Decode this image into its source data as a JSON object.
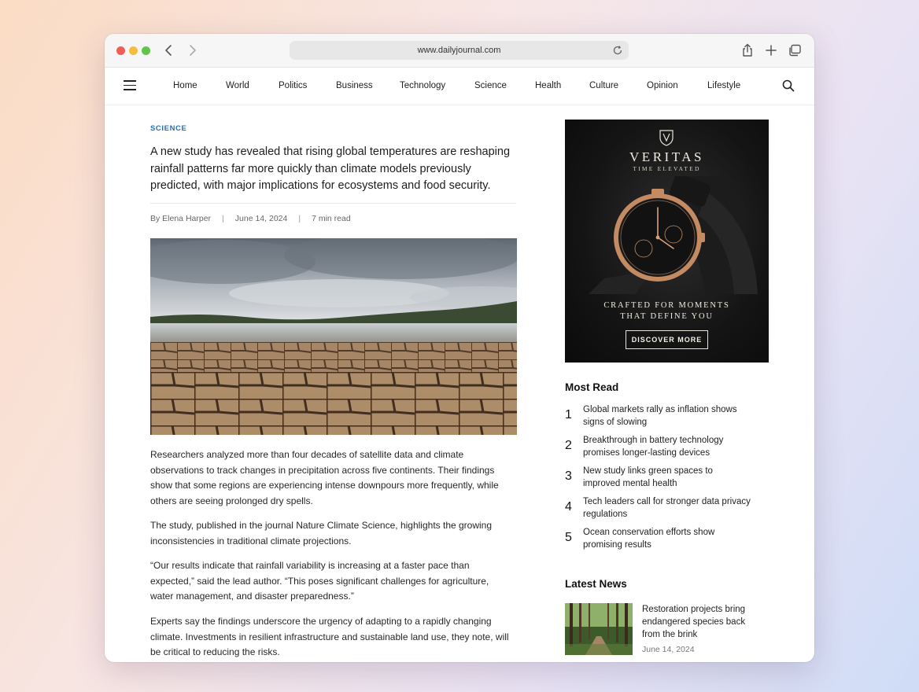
{
  "browser": {
    "url": "www.dailyjournal.com"
  },
  "nav": {
    "items": [
      "Home",
      "World",
      "Politics",
      "Business",
      "Technology",
      "Science",
      "Health",
      "Culture",
      "Opinion",
      "Lifestyle"
    ]
  },
  "article": {
    "category": "SCIENCE",
    "dek": "A new study has revealed that rising global temperatures are reshaping rainfall patterns far more quickly than climate models previously predicted, with major implications for ecosystems and food security.",
    "author": "By Elena Harper",
    "date": "June 14, 2024",
    "read_time": "7 min read",
    "paragraphs": [
      "Researchers analyzed more than four decades of satellite data and climate observations to track changes in precipitation across five continents. Their findings show that some regions are experiencing intense downpours more frequently, while others are seeing prolonged dry spells.",
      "The study, published in the journal Nature Climate Science, highlights the growing inconsistencies in traditional climate projections.",
      "“Our results indicate that rainfall variability is increasing at a faster pace than expected,” said the lead author. “This poses significant challenges for agriculture, water management, and disaster preparedness.”",
      "Experts say the findings underscore the urgency of adapting to a rapidly changing climate. Investments in resilient infrastructure and sustainable land use, they note, will be critical to reducing the risks."
    ]
  },
  "ad": {
    "brand": "VERITAS",
    "tagline": "TIME ELEVATED",
    "copy_line1": "CRAFTED FOR MOMENTS",
    "copy_line2": "THAT DEFINE YOU",
    "cta": "DISCOVER MORE"
  },
  "most_read": {
    "heading": "Most Read",
    "items": [
      {
        "num": "1",
        "title": "Global markets rally as inflation shows signs of slowing"
      },
      {
        "num": "2",
        "title": "Breakthrough in battery technology promises longer-lasting devices"
      },
      {
        "num": "3",
        "title": "New study links green spaces to improved mental health"
      },
      {
        "num": "4",
        "title": "Tech leaders call for stronger data privacy regulations"
      },
      {
        "num": "5",
        "title": "Ocean conservation efforts show promising results"
      }
    ]
  },
  "latest_news": {
    "heading": "Latest News",
    "items": [
      {
        "title": "Restoration projects bring endangered species back from the brink",
        "date": "June 14, 2024"
      }
    ]
  },
  "colors": {
    "category_accent": "#2a6fb4",
    "ad_background": "#111111"
  }
}
